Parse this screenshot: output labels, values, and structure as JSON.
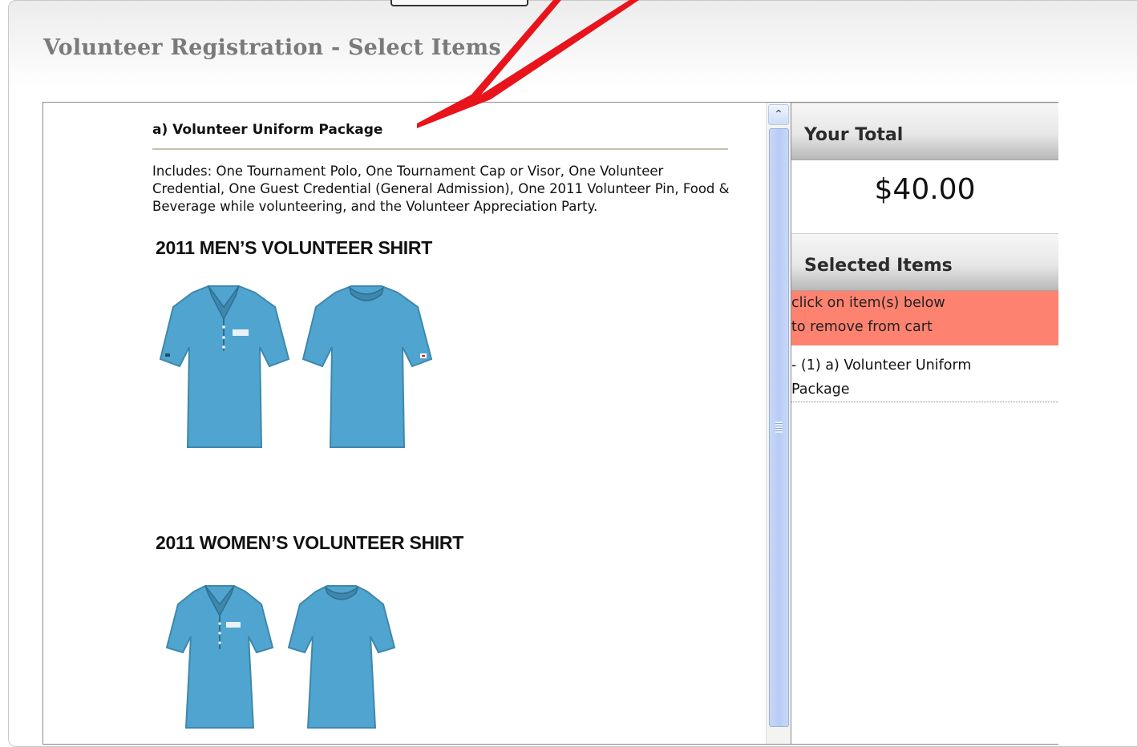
{
  "page": {
    "title": "Volunteer Registration - Select Items"
  },
  "item": {
    "title": "a) Volunteer Uniform Package",
    "description": "Includes: One Tournament Polo, One Tournament Cap or Visor, One Volunteer Credential, One Guest Credential (General Admission), One 2011 Volunteer Pin, Food & Beverage while volunteering, and the Volunteer Appreciation Party.",
    "mens_heading": "2011 MEN’S VOLUNTEER SHIRT",
    "womens_heading": "2011 WOMEN’S VOLUNTEER SHIRT"
  },
  "cart": {
    "total_header": "Your Total",
    "total_amount": "$40.00",
    "selected_header": "Selected Items",
    "remove_notice_line1": "click on item(s) below",
    "remove_notice_line2": "to remove from cart",
    "items": [
      {
        "line1": "- (1) a) Volunteer Uniform",
        "line2": "Package"
      }
    ]
  },
  "colors": {
    "shirt": "#4fa5cf",
    "shirt_dark": "#3f87ad",
    "annotation_arrow": "#e8131b",
    "remove_notice_bg": "#fd8270"
  },
  "icons": {
    "scroll_up": "chevron-up-icon"
  }
}
